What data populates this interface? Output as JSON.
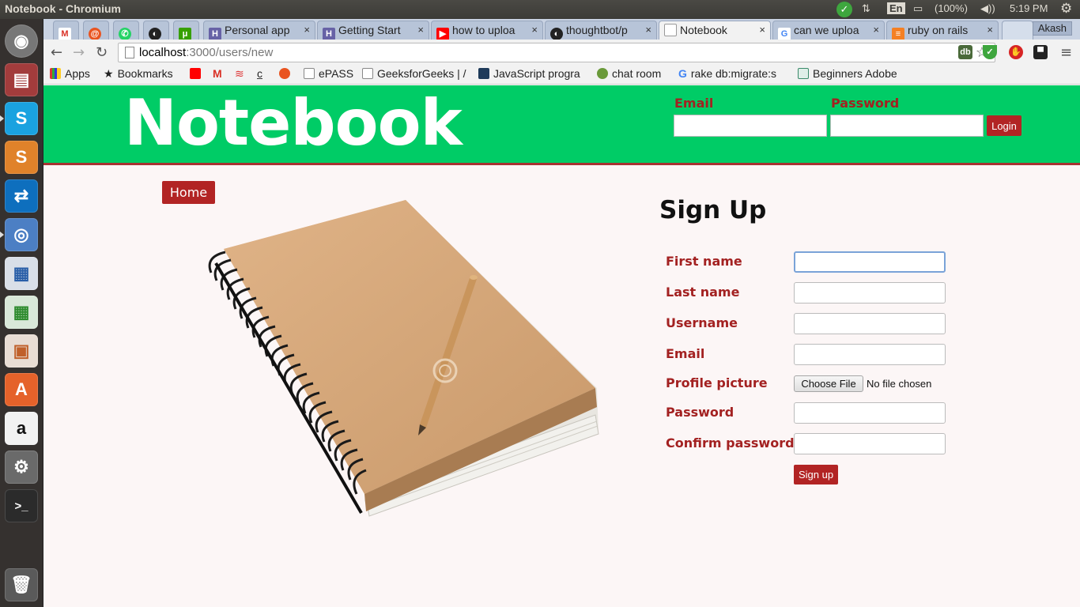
{
  "os": {
    "window_title": "Notebook - Chromium",
    "keyboard": "En",
    "battery": "(100%)",
    "time": "5:19 PM"
  },
  "browser": {
    "tabs": [
      {
        "label": "",
        "icon": "gmail-icon",
        "color": "#d93025"
      },
      {
        "label": "",
        "icon": "ubuntu-one-icon",
        "color": "#e95420"
      },
      {
        "label": "",
        "icon": "whatsapp-icon",
        "color": "#25d366"
      },
      {
        "label": "",
        "icon": "github-icon",
        "color": "#222222"
      },
      {
        "label": "",
        "icon": "upwork-icon",
        "color": "#37a000"
      },
      {
        "label": "Personal app",
        "icon": "heroku-icon",
        "color": "#6762a6"
      },
      {
        "label": "Getting Start",
        "icon": "heroku-icon",
        "color": "#6762a6"
      },
      {
        "label": "how to uploa",
        "icon": "youtube-icon",
        "color": "#ff0000"
      },
      {
        "label": "thoughtbot/p",
        "icon": "github-icon",
        "color": "#222222"
      },
      {
        "label": "Notebook",
        "icon": "page-icon",
        "color": "#999999"
      },
      {
        "label": "can we uploa",
        "icon": "google-icon",
        "color": "#4285f4"
      },
      {
        "label": "ruby on rails",
        "icon": "stackoverflow-icon",
        "color": "#f48024"
      }
    ],
    "user": "Akash",
    "url_host": "localhost",
    "url_path": ":3000/users/new",
    "bookmarks": [
      {
        "label": "Apps",
        "icon": "apps-grid-icon"
      },
      {
        "label": "Bookmarks",
        "icon": "star-icon"
      },
      {
        "label": "",
        "icon": "youtube-icon"
      },
      {
        "label": "",
        "icon": "gmail-icon"
      },
      {
        "label": "",
        "icon": "airtel-icon"
      },
      {
        "label": "",
        "icon": "bookmark-c-icon"
      },
      {
        "label": "",
        "icon": "ubuntu-one-icon"
      },
      {
        "label": "ePASS",
        "icon": "page-icon"
      },
      {
        "label": "GeeksforGeeks | /",
        "icon": "page-icon"
      },
      {
        "label": "JavaScript progra",
        "icon": "javascript-icon"
      },
      {
        "label": "chat room",
        "icon": "chat-room-icon"
      },
      {
        "label": "rake db:migrate:s",
        "icon": "google-icon"
      },
      {
        "label": "Beginners Adobe",
        "icon": "doc-icon"
      }
    ]
  },
  "header": {
    "brand": "Notebook",
    "email_label": "Email",
    "password_label": "Password",
    "login_label": "Login"
  },
  "nav": {
    "home_label": "Home"
  },
  "signup": {
    "title": "Sign Up",
    "fields": [
      {
        "label": "First name"
      },
      {
        "label": "Last name"
      },
      {
        "label": "Username"
      },
      {
        "label": "Email"
      },
      {
        "label": "Profile picture"
      },
      {
        "label": "Password"
      },
      {
        "label": "Confirm password"
      }
    ],
    "file_button": "Choose File",
    "file_status": "No file chosen",
    "submit_label": "Sign up"
  },
  "colors": {
    "header_bg": "#00cc66",
    "accent": "#b22424",
    "label_color": "#a32121"
  }
}
